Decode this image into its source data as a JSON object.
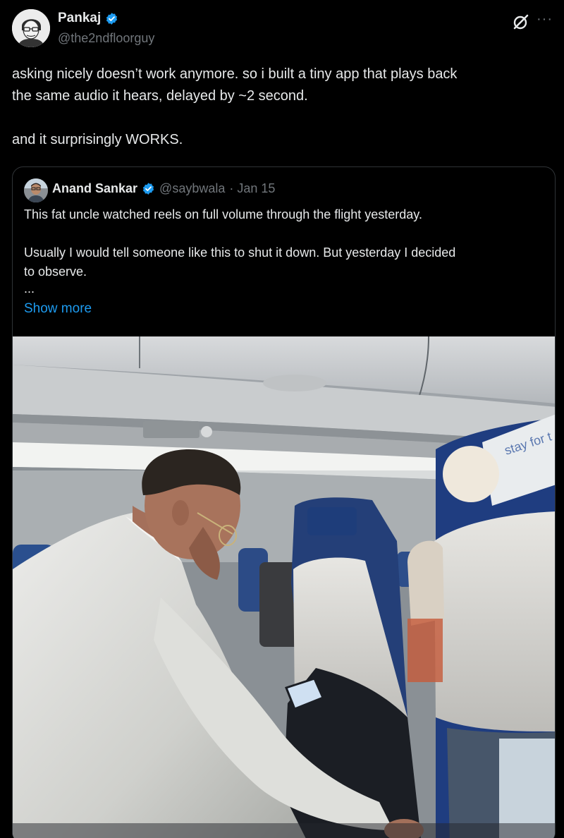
{
  "post": {
    "author": {
      "name": "Pankaj",
      "handle": "@the2ndfloorguy"
    },
    "text": {
      "line1": "asking nicely doesn’t work anymore. so i built a tiny app that plays back",
      "line2": "the same audio it hears, delayed by ~2 second.",
      "line3": "and it surprisingly WORKS."
    },
    "icons": {
      "verified": "verified-badge-icon",
      "grok": "grok-icon",
      "more": "more-options-icon"
    },
    "more_label": "···"
  },
  "quote": {
    "author": {
      "name": "Anand Sankar",
      "handle": "@saybwala",
      "date": "· Jan 15"
    },
    "text": {
      "line1": "This fat uncle watched reels on full volume through the flight yesterday.",
      "line2": "Usually I would tell someone like this to shut it down. But yesterday I decided",
      "line3": "to observe.",
      "ellipsis": "..."
    },
    "show_more": "Show more",
    "photo": {
      "headrest_text": "stay for t"
    }
  },
  "colors": {
    "background": "#000000",
    "text": "#e7e9ea",
    "secondary": "#71767b",
    "link": "#1d9bf0",
    "verified": "#1d9bf0",
    "border": "#2f3336"
  }
}
